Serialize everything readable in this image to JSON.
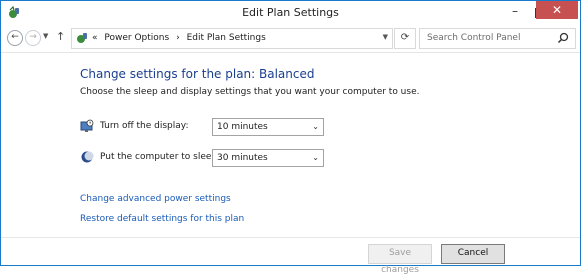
{
  "window": {
    "title": "Edit Plan Settings"
  },
  "nav": {
    "breadcrumb_prefix": "«",
    "crumbs": [
      "Power Options",
      "›",
      "Edit Plan Settings"
    ],
    "search_placeholder": "Search Control Panel"
  },
  "main": {
    "heading": "Change settings for the plan: Balanced",
    "subtext": "Choose the sleep and display settings that you want your computer to use.",
    "settings": [
      {
        "label": "Turn off the display:",
        "value": "10 minutes"
      },
      {
        "label": "Put the computer to sleep:",
        "value": "30 minutes"
      }
    ],
    "links": [
      "Change advanced power settings",
      "Restore default settings for this plan"
    ]
  },
  "footer": {
    "save_label": "Save changes",
    "cancel_label": "Cancel"
  },
  "icons": {
    "app": "power-options-icon",
    "display": "monitor-clock-icon",
    "sleep": "moon-icon",
    "search": "search-icon",
    "refresh": "refresh-icon"
  },
  "colors": {
    "heading": "#1a3f8f",
    "link": "#1a5bb8",
    "close": "#c75050",
    "border": "#1979ca"
  }
}
